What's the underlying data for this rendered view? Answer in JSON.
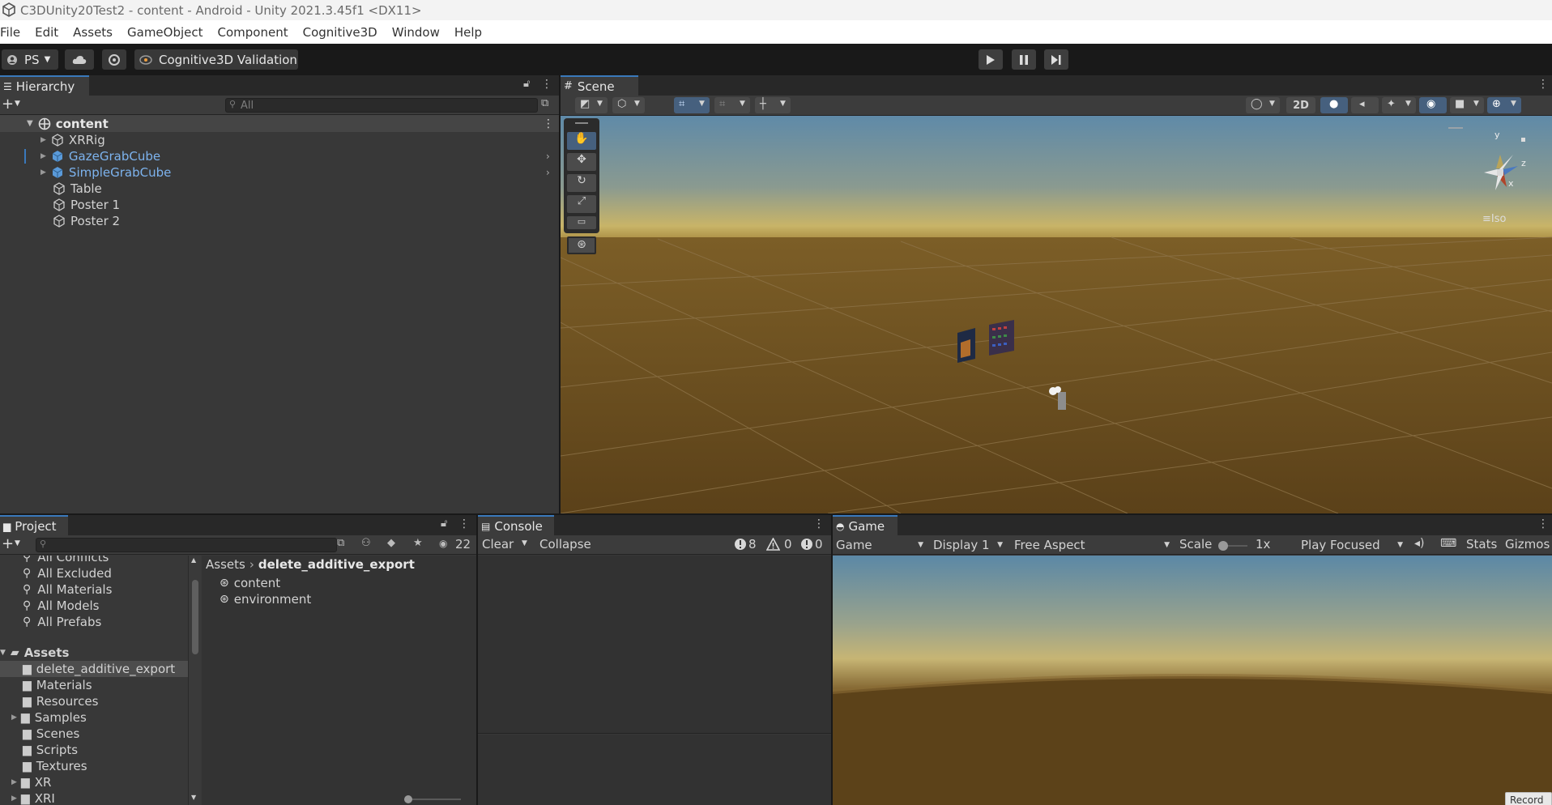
{
  "window": {
    "title": "C3DUnity20Test2 - content - Android - Unity 2021.3.45f1 <DX11>"
  },
  "menu": [
    "File",
    "Edit",
    "Assets",
    "GameObject",
    "Component",
    "Cognitive3D",
    "Window",
    "Help"
  ],
  "toolbar": {
    "account": "PS",
    "validation": "Cognitive3D Validation"
  },
  "hierarchy": {
    "tab": "Hierarchy",
    "search_placeholder": "All",
    "root": "content",
    "items": [
      "XRRig",
      "GazeGrabCube",
      "SimpleGrabCube",
      "Table",
      "Poster 1",
      "Poster 2"
    ]
  },
  "scene": {
    "tab": "Scene",
    "mode_2d": "2D",
    "iso": "Iso",
    "axis_y": "y",
    "axis_z": "z",
    "axis_x": "x"
  },
  "project": {
    "tab": "Project",
    "count": "22",
    "favorites": [
      "All Conflicts",
      "All Excluded",
      "All Materials",
      "All Models",
      "All Prefabs"
    ],
    "assets_label": "Assets",
    "folders": [
      "delete_additive_export",
      "Materials",
      "Resources",
      "Samples",
      "Scenes",
      "Scripts",
      "Textures",
      "XR",
      "XRI"
    ],
    "breadcrumb": [
      "Assets",
      "delete_additive_export"
    ],
    "files": [
      "content",
      "environment"
    ]
  },
  "console": {
    "tab": "Console",
    "clear": "Clear",
    "collapse": "Collapse",
    "info_count": "8",
    "warn_count": "0",
    "error_count": "0"
  },
  "game": {
    "tab": "Game",
    "view": "Game",
    "display": "Display 1",
    "aspect": "Free Aspect",
    "scale_label": "Scale",
    "scale_value": "1x",
    "play_mode": "Play Focused",
    "stats": "Stats",
    "gizmos": "Gizmos",
    "record": "Record"
  }
}
